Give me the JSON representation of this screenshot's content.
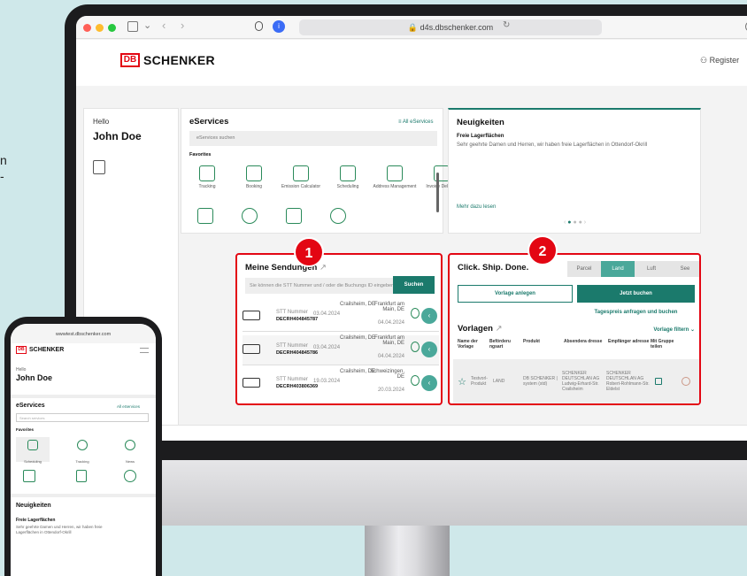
{
  "side_text": [
    "n",
    "-"
  ],
  "browser": {
    "url": "d4s.dbschenker.com",
    "register": "Register"
  },
  "brand": {
    "db": "DB",
    "name": "SCHENKER"
  },
  "sidebar": {
    "hello": "Hello",
    "name": "John Doe"
  },
  "eservices": {
    "title": "eServices",
    "all": "All eServices",
    "search_placeholder": "eServices suchen",
    "favorites": "Favorites",
    "tiles": [
      "Tracking",
      "Booking",
      "Emission Calculator",
      "Scheduling",
      "Address Management",
      "Invoice Delivery"
    ]
  },
  "news": {
    "title": "Neuigkeiten",
    "headline": "Freie Lagerflächen",
    "text": "Sehr geehrte Damen und Herren, wir haben freie Lagerflächen in Ottendorf-Okrill",
    "more": "Mehr dazu lesen"
  },
  "shipments": {
    "title": "Meine Sendungen",
    "placeholder": "Sie können die STT Nummer und / oder die Buchungs ID eingeben.",
    "search": "Suchen",
    "rows": [
      {
        "label": "STT Nummer",
        "id": "DECRH404845787",
        "date": "03.04.2024",
        "from": "Crailsheim, DE",
        "to": "Frankfurt am Main, DE",
        "to_date": "04.04.2024"
      },
      {
        "label": "STT Nummer",
        "id": "DECRH404845786",
        "date": "03.04.2024",
        "from": "Crailsheim, DE",
        "to": "Frankfurt am Main, DE",
        "to_date": "04.04.2024"
      },
      {
        "label": "STT Nummer",
        "id": "DECRH403806369",
        "date": "19.03.2024",
        "from": "Crailsheim, DE",
        "to": "Schweizingen, DE",
        "to_date": "20.03.2024"
      }
    ]
  },
  "click": {
    "title": "Click. Ship. Done.",
    "modes": [
      "Parcel",
      "Land",
      "Luft",
      "See"
    ],
    "btn_template": "Vorlage anlegen",
    "btn_book": "Jetzt buchen",
    "rates": "Tagespreis anfragen und buchen",
    "templates": "Vorlagen",
    "filter": "Vorlage filtern",
    "cols": [
      "Name der Vorlage",
      "Beförderu ngsart",
      "Produkt",
      "Absendera dresse",
      "Empfänger adresse",
      "Mit Gruppe teilen"
    ],
    "row": [
      "Testvorl-Produkt",
      "LAND",
      "DB SCHENKER | system (std)",
      "SCHENKER DEUTSCHLAN AG Ludwig-Erhard-Str. Crailsheim",
      "SCHENKER DEUTSCHLAN AG Robert-Rohlmann-Str. Eldelst"
    ]
  },
  "badges": [
    "1",
    "2"
  ],
  "phone": {
    "url": "wwwtest.dbschenker.com",
    "hello": "Hello",
    "name": "John Doe",
    "eservices": "eServices",
    "all": "All eServices",
    "search": "Search services",
    "favorites": "Favorites",
    "tiles": [
      "Scheduling",
      "Tracking",
      "News"
    ],
    "news_title": "Neuigkeiten",
    "news_headline": "Freie Lagerflächen",
    "news_text": "Sehr geehrte Damen und Herren, wir haben freie Lagerflächen in Ottendorf-Okrill"
  }
}
